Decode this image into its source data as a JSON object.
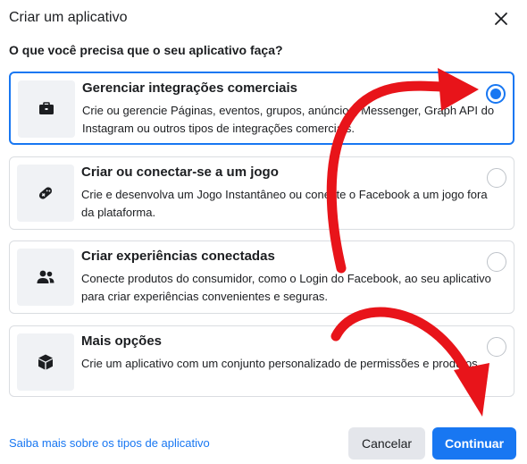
{
  "dialog": {
    "title": "Criar um aplicativo",
    "question": "O que você precisa que o seu aplicativo faça?"
  },
  "options": [
    {
      "title": "Gerenciar integrações comerciais",
      "description": "Crie ou gerencie Páginas, eventos, grupos, anúncios, Messenger, Graph API do Instagram ou outros tipos de integrações comerciais.",
      "icon": "briefcase-icon",
      "selected": true
    },
    {
      "title": "Criar ou conectar-se a um jogo",
      "description": "Crie e desenvolva um Jogo Instantâneo ou conecte o Facebook a um jogo fora da plataforma.",
      "icon": "gamepad-icon",
      "selected": false
    },
    {
      "title": "Criar experiências conectadas",
      "description": "Conecte produtos do consumidor, como o Login do Facebook, ao seu aplicativo para criar experiências convenientes e seguras.",
      "icon": "people-icon",
      "selected": false
    },
    {
      "title": "Mais opções",
      "description": "Crie um aplicativo com um conjunto personalizado de permissões e produtos.",
      "icon": "cube-icon",
      "selected": false
    }
  ],
  "footer": {
    "learn_more": "Saiba mais sobre os tipos de aplicativo",
    "cancel": "Cancelar",
    "continue": "Continuar"
  },
  "colors": {
    "accent": "#1877f2",
    "annotation_arrow": "#e8141a"
  }
}
